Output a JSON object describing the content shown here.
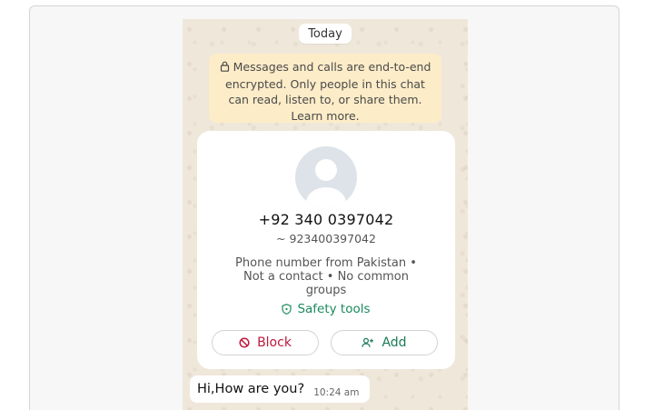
{
  "chat": {
    "date_chip": "Today",
    "encryption_notice": "Messages and calls are end-to-end encrypted. Only people in this chat can read, listen to, or share them. Learn more.",
    "contact": {
      "phone": "+92 340 0397042",
      "alt_number": "~ 923400397042",
      "info_line1": "Phone number from Pakistan •",
      "info_line2": "Not a contact • No common",
      "info_line3": "groups",
      "safety_label": "Safety tools",
      "block_label": "Block",
      "add_label": "Add"
    },
    "message": {
      "text": "Hi,How are you?",
      "time": "10:24 am"
    }
  },
  "colors": {
    "chat_background": "#efe7da",
    "encryption_bubble": "#fcecc8",
    "block_red": "#c0183d",
    "accent_green": "#1a8a5a"
  },
  "icons": [
    "lock-icon",
    "avatar-icon",
    "shield-icon",
    "block-icon",
    "add-contact-icon"
  ]
}
